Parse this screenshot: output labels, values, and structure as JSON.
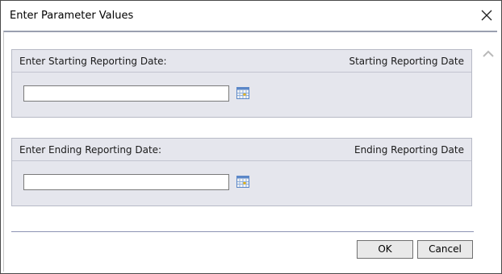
{
  "window": {
    "title": "Enter Parameter Values"
  },
  "icons": {
    "close": "close-icon",
    "scroll_up": "chevron-up-icon",
    "calendar": "calendar-icon"
  },
  "start_panel": {
    "prompt": "Enter Starting Reporting Date:",
    "name": "Starting Reporting Date",
    "value": ""
  },
  "end_panel": {
    "prompt": "Enter Ending Reporting Date:",
    "name": "Ending Reporting Date",
    "value": ""
  },
  "buttons": {
    "ok": "OK",
    "cancel": "Cancel"
  },
  "colors": {
    "panel_bg": "#e5e6ed",
    "panel_border": "#b7bac6",
    "separator": "#8d93b4"
  }
}
